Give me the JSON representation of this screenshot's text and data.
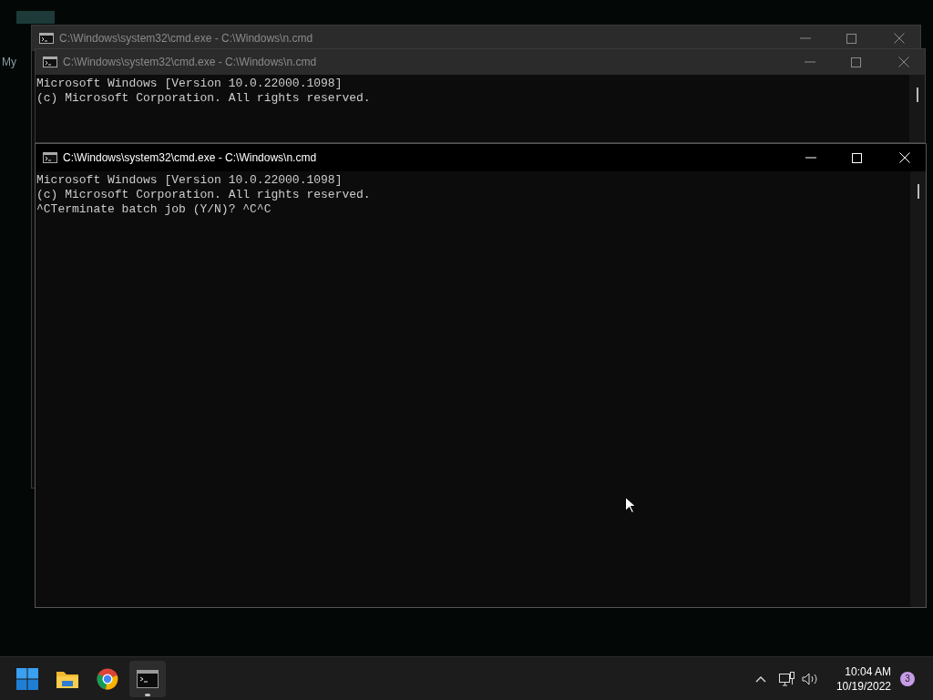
{
  "desktop": {
    "icon_label": "My"
  },
  "windows": [
    {
      "title": "C:\\Windows\\system32\\cmd.exe - C:\\Windows\\n.cmd",
      "active": false
    },
    {
      "title": "C:\\Windows\\system32\\cmd.exe - C:\\Windows\\n.cmd",
      "active": false,
      "lines": [
        "Microsoft Windows [Version 10.0.22000.1098]",
        "(c) Microsoft Corporation. All rights reserved."
      ]
    },
    {
      "title": "C:\\Windows\\system32\\cmd.exe - C:\\Windows\\n.cmd",
      "active": true,
      "lines": [
        "Microsoft Windows [Version 10.0.22000.1098]",
        "(c) Microsoft Corporation. All rights reserved.",
        "^CTerminate batch job (Y/N)? ^C^C"
      ]
    }
  ],
  "taskbar": {
    "apps": [
      {
        "kind": "start",
        "selected": false
      },
      {
        "kind": "folder",
        "selected": false
      },
      {
        "kind": "browser",
        "selected": false
      },
      {
        "kind": "terminal",
        "selected": true
      }
    ],
    "time": "10:04 AM",
    "date": "10/19/2022",
    "notifications": "3"
  }
}
